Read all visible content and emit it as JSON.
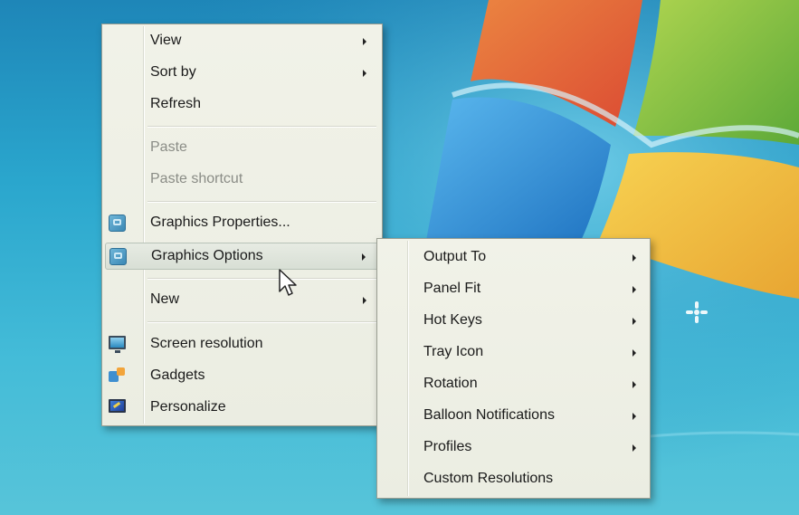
{
  "context_menu": {
    "items": [
      {
        "label": "View",
        "has_submenu": true,
        "enabled": true
      },
      {
        "label": "Sort by",
        "has_submenu": true,
        "enabled": true
      },
      {
        "label": "Refresh",
        "has_submenu": false,
        "enabled": true
      },
      {
        "label": "Paste",
        "has_submenu": false,
        "enabled": false
      },
      {
        "label": "Paste shortcut",
        "has_submenu": false,
        "enabled": false
      },
      {
        "label": "Graphics Properties...",
        "has_submenu": false,
        "enabled": true,
        "icon": "graphics-icon"
      },
      {
        "label": "Graphics Options",
        "has_submenu": true,
        "enabled": true,
        "icon": "graphics-icon",
        "highlighted": true
      },
      {
        "label": "New",
        "has_submenu": true,
        "enabled": true
      },
      {
        "label": "Screen resolution",
        "has_submenu": false,
        "enabled": true,
        "icon": "screen-resolution-icon"
      },
      {
        "label": "Gadgets",
        "has_submenu": false,
        "enabled": true,
        "icon": "gadgets-icon"
      },
      {
        "label": "Personalize",
        "has_submenu": false,
        "enabled": true,
        "icon": "personalize-icon"
      }
    ]
  },
  "graphics_options_submenu": {
    "items": [
      {
        "label": "Output To",
        "has_submenu": true
      },
      {
        "label": "Panel Fit",
        "has_submenu": true
      },
      {
        "label": "Hot Keys",
        "has_submenu": true
      },
      {
        "label": "Tray Icon",
        "has_submenu": true
      },
      {
        "label": "Rotation",
        "has_submenu": true
      },
      {
        "label": "Balloon Notifications",
        "has_submenu": true
      },
      {
        "label": "Profiles",
        "has_submenu": true
      },
      {
        "label": "Custom Resolutions",
        "has_submenu": false
      }
    ]
  },
  "colors": {
    "desktop_background": "#2ea9cf",
    "menu_background": "#eef0e5",
    "disabled_text": "#8a8c86",
    "windows_logo": [
      "#f0642a",
      "#7dbd3a",
      "#2b8fd6",
      "#f5c32a"
    ]
  }
}
